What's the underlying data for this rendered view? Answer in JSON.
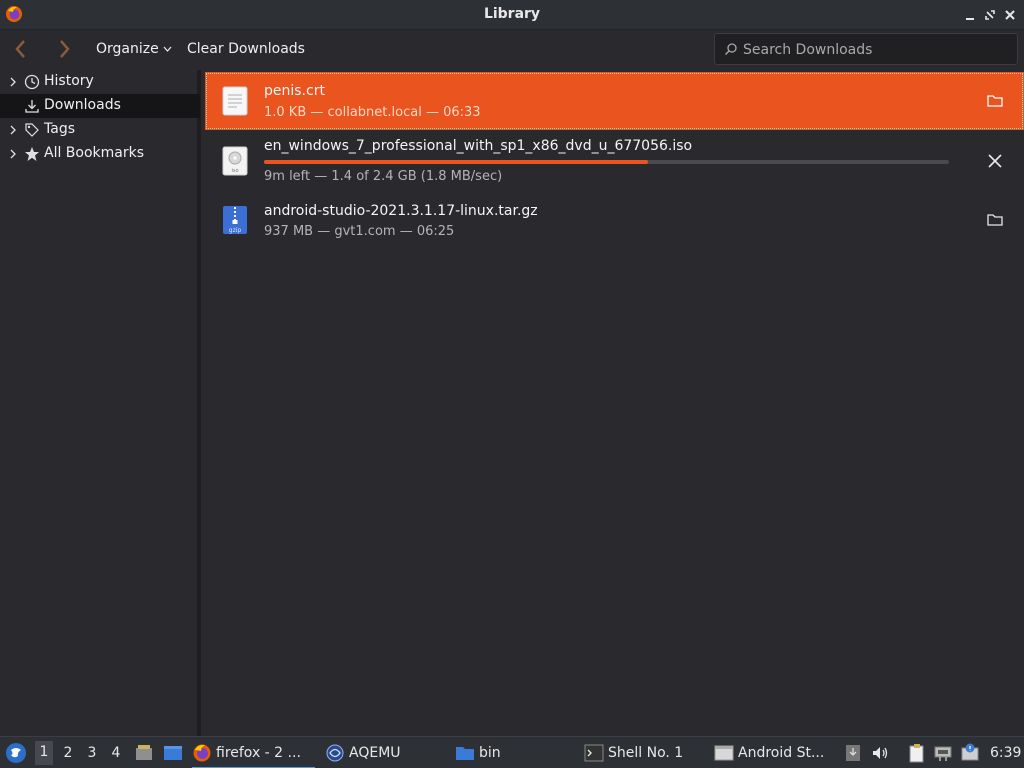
{
  "window": {
    "title": "Library",
    "icon": "firefox-icon"
  },
  "toolbar": {
    "organize_label": "Organize",
    "clear_label": "Clear Downloads",
    "search_placeholder": "Search Downloads"
  },
  "sidebar": {
    "items": [
      {
        "label": "History",
        "icon": "clock-icon",
        "expandable": true
      },
      {
        "label": "Downloads",
        "icon": "download-icon",
        "expandable": false,
        "selected": true
      },
      {
        "label": "Tags",
        "icon": "tags-icon",
        "expandable": true
      },
      {
        "label": "All Bookmarks",
        "icon": "star-icon",
        "expandable": true
      }
    ]
  },
  "downloads": [
    {
      "name": "penis.crt",
      "status": "1.0 KB — collabnet.local — 06:33",
      "icon": "text-file-icon",
      "action": "open-folder-icon"
    },
    {
      "name": "en_windows_7_professional_with_sp1_x86_dvd_u_677056.iso",
      "status": "9m left — 1.4 of 2.4 GB (1.8 MB/sec)",
      "icon": "iso-file-icon",
      "action": "cancel-icon",
      "progress": 0.56
    },
    {
      "name": "android-studio-2021.3.1.17-linux.tar.gz",
      "status": "937 MB — gvt1.com — 06:25",
      "icon": "archive-file-icon",
      "action": "open-folder-icon"
    }
  ],
  "taskbar": {
    "workspaces": [
      "1",
      "2",
      "3",
      "4"
    ],
    "active_workspace": "1",
    "tasks": [
      {
        "label": "firefox - 2 ...",
        "icon": "firefox-icon"
      },
      {
        "label": "AQEMU",
        "icon": "aqemu-icon"
      },
      {
        "label": "bin",
        "icon": "folder-icon"
      },
      {
        "label": "Shell No. 1",
        "icon": "terminal-icon"
      },
      {
        "label": "Android St...",
        "icon": "window-icon"
      }
    ],
    "clock": "6:39"
  },
  "colors": {
    "accent": "#e9541f",
    "background": "#2a2a2e",
    "selected_sidebar": "#151517"
  }
}
